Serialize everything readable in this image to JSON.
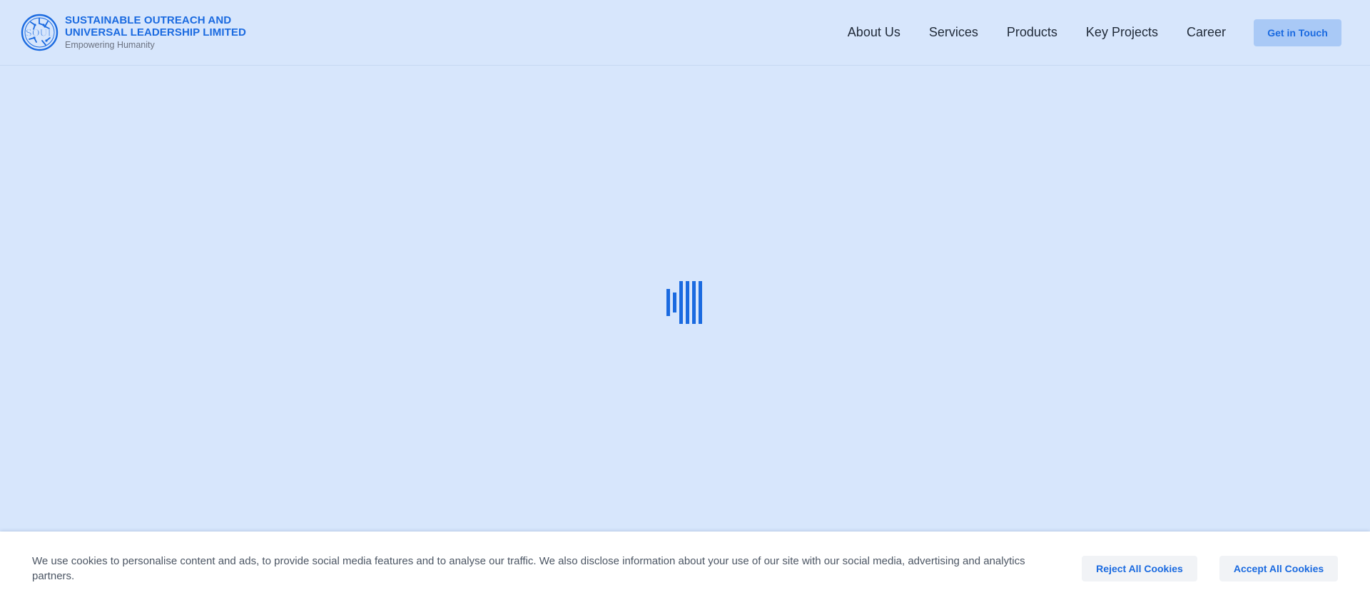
{
  "header": {
    "brand": {
      "logo_text": "SOUL",
      "name_line1": "SUSTAINABLE OUTREACH AND",
      "name_line2": "UNIVERSAL LEADERSHIP LIMITED",
      "tagline": "Empowering Humanity"
    },
    "nav": [
      {
        "label": "About Us"
      },
      {
        "label": "Services"
      },
      {
        "label": "Products"
      },
      {
        "label": "Key Projects"
      },
      {
        "label": "Career"
      }
    ],
    "cta_label": "Get in Touch"
  },
  "loader": {
    "icon": "loading-bars-icon",
    "color": "#1a6ae0"
  },
  "cookie_banner": {
    "message": "We use cookies to personalise content and ads, to provide social media features and to analyse our traffic. We also disclose information about your use of our site with our social media, advertising and analytics partners.",
    "reject_label": "Reject All Cookies",
    "accept_label": "Accept All Cookies"
  },
  "colors": {
    "background": "#d7e6fc",
    "accent": "#1a6ae0",
    "cta_background": "#a9c9f6",
    "banner_background": "#ffffff"
  }
}
